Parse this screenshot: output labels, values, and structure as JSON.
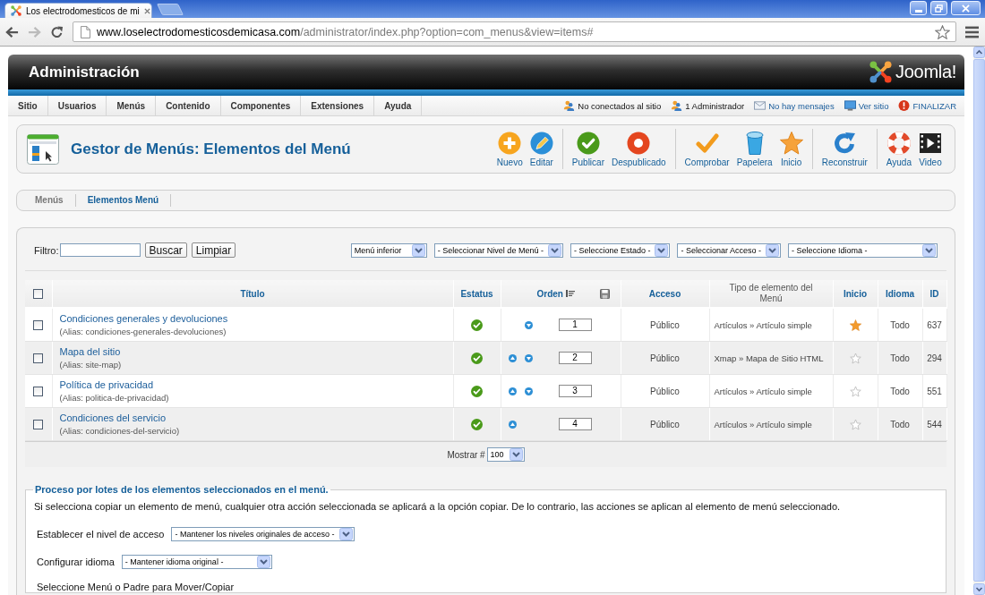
{
  "browser": {
    "tab_title": "Los electrodomesticos de mi",
    "url_host": "www.loselectrodomesticosdemicasa.com",
    "url_path": "/administrator/index.php?option=com_menus&view=items#"
  },
  "header": {
    "title": "Administración",
    "logo_text": "Joomla!"
  },
  "main_menu": [
    "Sitio",
    "Usuarios",
    "Menús",
    "Contenido",
    "Componentes",
    "Extensiones",
    "Ayuda"
  ],
  "status_items": [
    {
      "kind": "users",
      "label": "No conectados al sitio"
    },
    {
      "kind": "admins",
      "label": "1 Administrador"
    },
    {
      "kind": "messages",
      "label": "No hay mensajes"
    },
    {
      "kind": "site",
      "label": "Ver sitio"
    },
    {
      "kind": "logout",
      "label": "FINALIZAR"
    }
  ],
  "page_title": "Gestor de Menús: Elementos del Menú",
  "toolbar_groups": [
    {
      "buttons": [
        {
          "kind": "new",
          "label": "Nuevo"
        },
        {
          "kind": "edit",
          "label": "Editar"
        }
      ]
    },
    {
      "buttons": [
        {
          "kind": "publish",
          "label": "Publicar"
        },
        {
          "kind": "unpublish",
          "label": "Despublicado"
        }
      ]
    },
    {
      "buttons": [
        {
          "kind": "checkin",
          "label": "Comprobar"
        },
        {
          "kind": "trash",
          "label": "Papelera"
        },
        {
          "kind": "default",
          "label": "Inicio"
        }
      ]
    },
    {
      "buttons": [
        {
          "kind": "rebuild",
          "label": "Reconstruir"
        }
      ]
    },
    {
      "buttons": [
        {
          "kind": "help",
          "label": "Ayuda"
        },
        {
          "kind": "video",
          "label": "Video"
        }
      ]
    }
  ],
  "submenu": [
    {
      "label": "Menús",
      "selected": false
    },
    {
      "label": "Elementos Menú",
      "selected": true
    }
  ],
  "filter": {
    "label": "Filtro:",
    "buttons": [
      "Buscar",
      "Limpiar"
    ],
    "selects": [
      "Menú inferior",
      "- Seleccionar Nivel de Menú -",
      "- Seleccione Estado -",
      "- Seleccionar Acceso -",
      "- Seleccione Idioma -"
    ]
  },
  "table": {
    "columns": [
      {
        "kind": "checkbox",
        "checked": false
      },
      {
        "kind": "link",
        "label": "Título"
      },
      {
        "kind": "link",
        "label": "Estatus"
      },
      {
        "kind": "sorted",
        "label": "Orden"
      },
      {
        "kind": "link",
        "label": "Acceso"
      },
      {
        "kind": "plain",
        "label": "Tipo de elemento del Menú"
      },
      {
        "kind": "link",
        "label": "Inicio"
      },
      {
        "kind": "link",
        "label": "Idioma"
      },
      {
        "kind": "link",
        "label": "ID"
      }
    ],
    "rows": [
      {
        "checked": false,
        "title": "Condiciones generales y devoluciones",
        "alias": "(Alias: condiciones-generales-devoluciones)",
        "published": true,
        "can_move_up": false,
        "can_move_down": true,
        "order": "1",
        "access": "Público",
        "type": "Artículos » Artículo simple",
        "home": true,
        "language": "Todo",
        "id": "637"
      },
      {
        "checked": false,
        "title": "Mapa del sitio",
        "alias": "(Alias: site-map)",
        "published": true,
        "can_move_up": true,
        "can_move_down": true,
        "order": "2",
        "access": "Público",
        "type": "Xmap » Mapa de Sitio HTML",
        "home": false,
        "language": "Todo",
        "id": "294"
      },
      {
        "checked": false,
        "title": "Política de privacidad",
        "alias": "(Alias: politica-de-privacidad)",
        "published": true,
        "can_move_up": true,
        "can_move_down": true,
        "order": "3",
        "access": "Público",
        "type": "Artículos » Artículo simple",
        "home": false,
        "language": "Todo",
        "id": "551"
      },
      {
        "checked": false,
        "title": "Condiciones del servicio",
        "alias": "(Alias: condiciones-del-servicio)",
        "published": true,
        "can_move_up": true,
        "can_move_down": false,
        "order": "4",
        "access": "Público",
        "type": "Artículos » Artículo simple",
        "home": false,
        "language": "Todo",
        "id": "544"
      }
    ]
  },
  "pagination": {
    "label": "Mostrar #",
    "value": "100"
  },
  "batch": {
    "legend": "Proceso por lotes de los elementos seleccionados en el menú.",
    "note": "Si selecciona copiar un elemento de menú, cualquier otra acción seleccionada se aplicará a la opción copiar. De lo contrario, las acciones se aplican al elemento de menú seleccionado.",
    "fields": [
      {
        "label": "Establecer el nivel de acceso",
        "value": "- Mantener los niveles originales de acceso -"
      },
      {
        "label": "Configurar idioma",
        "value": "- Mantener idioma original -"
      }
    ],
    "move_label": "Seleccione Menú o Padre para Mover/Copiar"
  }
}
